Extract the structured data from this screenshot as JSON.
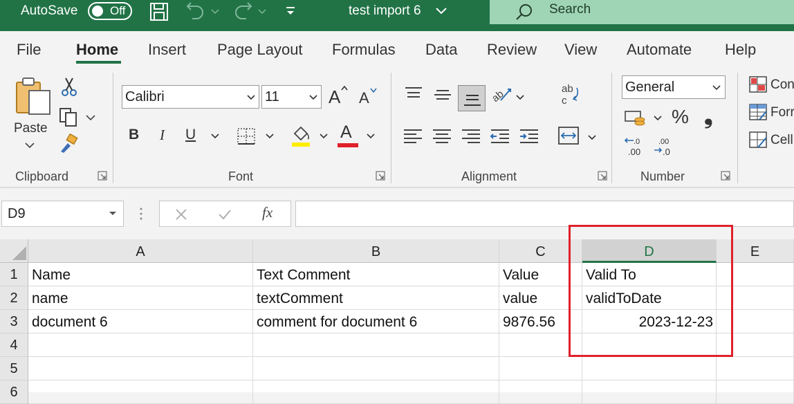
{
  "titlebar": {
    "autosave_label": "AutoSave",
    "autosave_state": "Off",
    "doc_title": "test import 6",
    "search_placeholder": "Search",
    "accent": "#217346"
  },
  "menu": {
    "items": [
      "File",
      "Home",
      "Insert",
      "Page Layout",
      "Formulas",
      "Data",
      "Review",
      "View",
      "Automate",
      "Help"
    ],
    "active": "Home"
  },
  "ribbon": {
    "clipboard": {
      "paste_label": "Paste",
      "group_label": "Clipboard"
    },
    "font": {
      "font_name": "Calibri",
      "font_size": "11",
      "group_label": "Font",
      "bold": "B",
      "italic": "I",
      "underline": "U",
      "font_color_letter": "A"
    },
    "alignment": {
      "group_label": "Alignment"
    },
    "number": {
      "format": "General",
      "group_label": "Number",
      "percent": "%",
      "comma": "❟"
    },
    "styles": {
      "items": [
        "Con",
        "Forr",
        "Cell"
      ]
    }
  },
  "formula_bar": {
    "name_box": "D9",
    "fx": "fx",
    "formula": ""
  },
  "sheet": {
    "columns": [
      "A",
      "B",
      "C",
      "D",
      "E"
    ],
    "selected_column": "D",
    "rows": [
      "1",
      "2",
      "3",
      "4",
      "5",
      "6"
    ],
    "cells": [
      [
        "Name",
        "Text Comment",
        "Value",
        "Valid To",
        ""
      ],
      [
        "name",
        "textComment",
        "value",
        "validToDate",
        ""
      ],
      [
        "document 6",
        "comment for document 6",
        "9876.56",
        "2023-12-23",
        ""
      ],
      [
        "",
        "",
        "",
        "",
        ""
      ],
      [
        "",
        "",
        "",
        "",
        ""
      ]
    ],
    "highlight_color": "#e0202a"
  }
}
